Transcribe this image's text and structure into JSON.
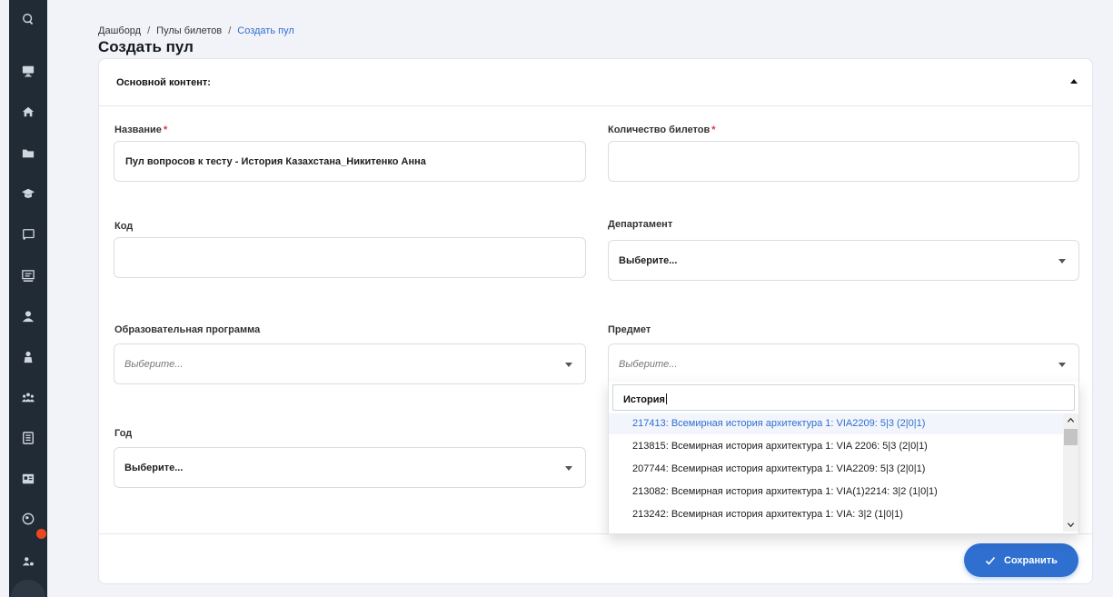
{
  "breadcrumb": {
    "items": [
      "Дашборд",
      "Пулы билетов",
      "Создать пул"
    ],
    "separator": "/"
  },
  "page_title": "Создать пул",
  "card": {
    "header_title": "Основной контент:",
    "fields": {
      "name": {
        "label": "Название",
        "required_mark": "*",
        "value": "Пул вопросов к тесту - История Казахстана_Никитенко Анна"
      },
      "tickets_count": {
        "label": "Количество билетов",
        "required_mark": "*",
        "value": ""
      },
      "code": {
        "label": "Код",
        "value": ""
      },
      "department": {
        "label": "Департамент",
        "selected": "Выберите..."
      },
      "program": {
        "label": "Образовательная программа",
        "placeholder": "Выберите..."
      },
      "subject": {
        "label": "Предмет",
        "placeholder": "Выберите..."
      },
      "year": {
        "label": "Год",
        "selected": "Выберите..."
      }
    },
    "save_label": "Сохранить"
  },
  "subject_dropdown": {
    "search_value": "История",
    "options": [
      "217413: Всемирная история архитектура 1: VIA2209: 5|3 (2|0|1)",
      "213815: Всемирная история архитектура 1: VIA 2206: 5|3 (2|0|1)",
      "207744: Всемирная история архитектура 1: VIA2209: 5|3 (2|0|1)",
      "213082: Всемирная история архитектура 1: VIA(1)2214: 3|2 (1|0|1)",
      "213242: Всемирная история архитектура 1: VIA: 3|2 (1|0|1)"
    ],
    "highlighted_index": 0
  },
  "colors": {
    "accent": "#2f6fd0",
    "sidebar_bg": "#212b36",
    "required": "#e1323c",
    "notification_badge": "#e8491e"
  },
  "sidebar_icons": [
    "search-icon",
    "monitor-icon",
    "home-icon",
    "folder-icon",
    "graduation-cap-icon",
    "cast-icon",
    "presentation-icon",
    "user-icon",
    "teacher-icon",
    "group-icon",
    "document-icon",
    "id-card-icon",
    "globe-icon",
    "user-settings-icon"
  ]
}
